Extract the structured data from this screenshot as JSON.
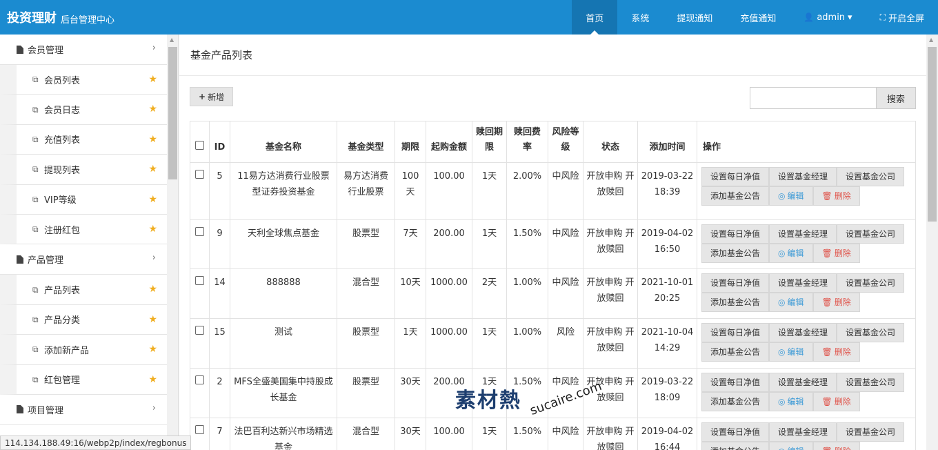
{
  "brand": {
    "title": "投资理财",
    "subtitle": "后台管理中心"
  },
  "topnav": [
    {
      "label": "首页",
      "active": true
    },
    {
      "label": "系统"
    },
    {
      "label": "提现通知"
    },
    {
      "label": "充值通知"
    },
    {
      "label": "admin",
      "icon": "user-icon",
      "caret": "▾"
    },
    {
      "label": "开启全屏",
      "icon": "expand-icon"
    }
  ],
  "sidebar": {
    "groups": [
      {
        "label": "会员管理",
        "items": [
          "会员列表",
          "会员日志",
          "充值列表",
          "提现列表",
          "VIP等级",
          "注册红包"
        ]
      },
      {
        "label": "产品管理",
        "items": [
          "产品列表",
          "产品分类",
          "添加新产品",
          "红包管理"
        ]
      },
      {
        "label": "项目管理",
        "items": []
      }
    ]
  },
  "page": {
    "title": "基金产品列表",
    "add_label": "新增",
    "search_label": "搜索",
    "search_placeholder": ""
  },
  "table": {
    "headers": [
      "ID",
      "基金名称",
      "基金类型",
      "期限",
      "起购金额",
      "赎回期限",
      "赎回费率",
      "风险等级",
      "状态",
      "添加时间",
      "操作"
    ],
    "ops": [
      "设置每日净值",
      "设置基金经理",
      "设置基金公司",
      "添加基金公告",
      "编辑",
      "删除"
    ],
    "rows": [
      {
        "id": "5",
        "name": "11易方达消费行业股票型证券投资基金",
        "type": "易方达消费行业股票",
        "term": "100天",
        "min": "100.00",
        "redeem_term": "1天",
        "fee": "2.00%",
        "risk": "中风险",
        "status": "开放申购 开放赎回",
        "time": "2019-03-22 18:39"
      },
      {
        "id": "9",
        "name": "天利全球焦点基金",
        "type": "股票型",
        "term": "7天",
        "min": "200.00",
        "redeem_term": "1天",
        "fee": "1.50%",
        "risk": "中风险",
        "status": "开放申购 开放赎回",
        "time": "2019-04-02 16:50"
      },
      {
        "id": "14",
        "name": "888888",
        "type": "混合型",
        "term": "10天",
        "min": "1000.00",
        "redeem_term": "2天",
        "fee": "1.00%",
        "risk": "中风险",
        "status": "开放申购 开放赎回",
        "time": "2021-10-01 20:25"
      },
      {
        "id": "15",
        "name": "测试",
        "type": "股票型",
        "term": "1天",
        "min": "1000.00",
        "redeem_term": "1天",
        "fee": "1.00%",
        "risk": "风险",
        "status": "开放申购 开放赎回",
        "time": "2021-10-04 14:29"
      },
      {
        "id": "2",
        "name": "MFS全盛美国集中持股成长基金",
        "type": "股票型",
        "term": "30天",
        "min": "200.00",
        "redeem_term": "1天",
        "fee": "1.50%",
        "risk": "中风险",
        "status": "开放申购 开放赎回",
        "time": "2019-03-22 18:09"
      },
      {
        "id": "7",
        "name": "法巴百利达新兴市场精选基金",
        "type": "混合型",
        "term": "30天",
        "min": "100.00",
        "redeem_term": "1天",
        "fee": "1.50%",
        "risk": "中风险",
        "status": "开放申购 开放赎回",
        "time": "2019-04-02 16:44"
      }
    ]
  },
  "status_url": "114.134.188.49:16/webp2p/index/regbonus",
  "watermark": {
    "logo": "素材熱",
    "url": "sucaire.com"
  },
  "colors": {
    "topbar": "#1b8bd0",
    "active_nav": "#1575b2",
    "star": "#f0ad1e",
    "edit": "#3c9ad6",
    "delete": "#e0534a"
  }
}
